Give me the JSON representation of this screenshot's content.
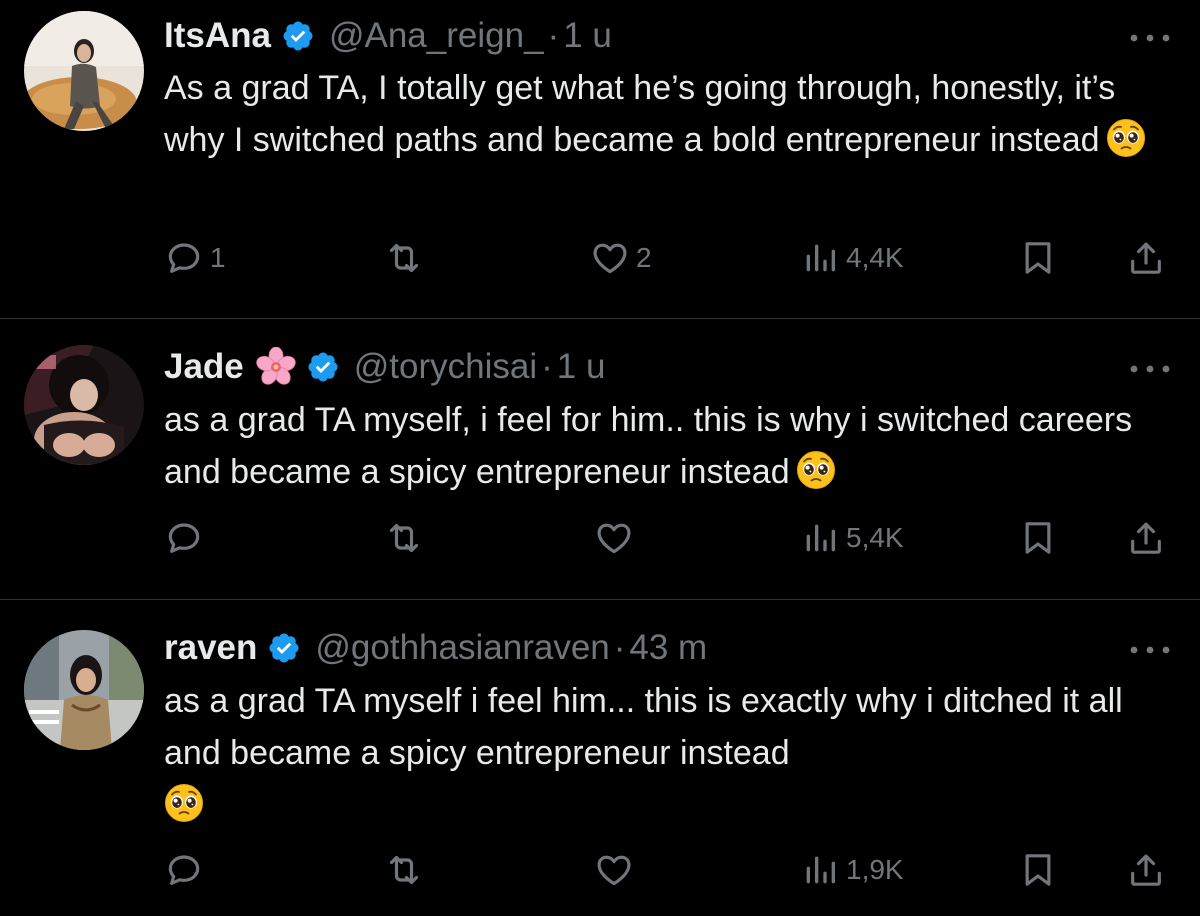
{
  "colors": {
    "background": "#000000",
    "text_primary": "#e7e9ea",
    "text_secondary": "#71767b",
    "verified": "#1d9bf0",
    "divider": "#2f3336"
  },
  "tweets": [
    {
      "name": "ItsAna",
      "handle": "@Ana_reign_",
      "separator": "·",
      "time": "1 u",
      "text": "As a grad TA, I totally get what he’s going through, honestly, it’s why I switched paths and became a bold entrepreneur instead",
      "name_emoji": "",
      "replies": "1",
      "reposts": "",
      "likes": "2",
      "views": "4,4K"
    },
    {
      "name": "Jade",
      "handle": "@torychisai",
      "separator": "·",
      "time": "1 u",
      "text": "as a grad TA myself, i feel for him.. this is why i switched careers and became a spicy entrepreneur instead",
      "name_emoji": "cherry-blossom",
      "replies": "",
      "reposts": "",
      "likes": "",
      "views": "5,4K"
    },
    {
      "name": "raven",
      "handle": "@gothhasianraven",
      "separator": "·",
      "time": "43 m",
      "text": "as a grad TA myself i feel him... this is exactly why i ditched it all and became a spicy entrepreneur instead",
      "name_emoji": "",
      "replies": "",
      "reposts": "",
      "likes": "",
      "views": "1,9K"
    }
  ],
  "icons": {
    "verified": "verified-badge-icon",
    "more": "more-options-icon",
    "reply": "reply-icon",
    "repost": "repost-icon",
    "like": "heart-icon",
    "views": "views-icon",
    "bookmark": "bookmark-icon",
    "share": "share-icon",
    "emoji": "pleading-face-emoji-icon",
    "flower": "cherry-blossom-emoji-icon"
  }
}
